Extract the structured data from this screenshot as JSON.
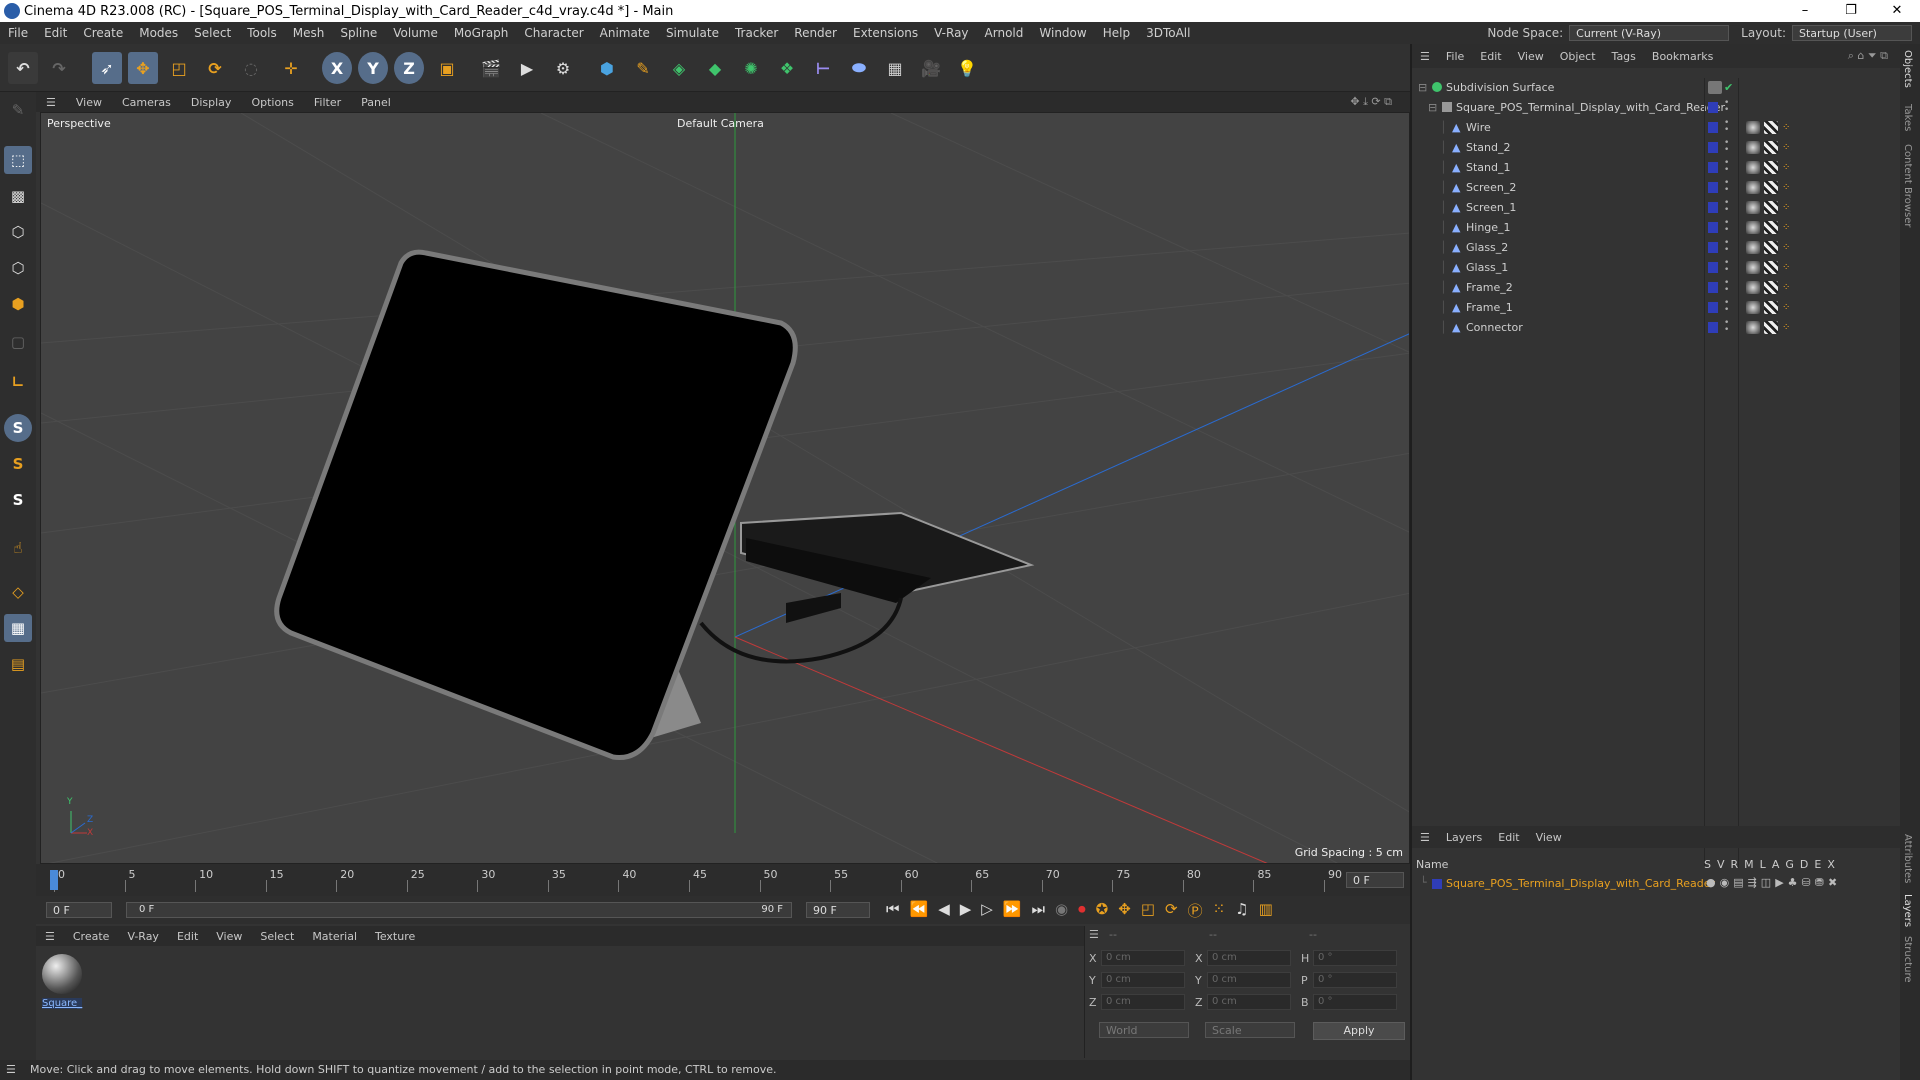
{
  "window": {
    "title": "Cinema 4D R23.008 (RC) - [Square_POS_Terminal_Display_with_Card_Reader_c4d_vray.c4d *] - Main",
    "controls": [
      "–",
      "❐",
      "✕"
    ]
  },
  "menubar": {
    "items": [
      "File",
      "Edit",
      "Create",
      "Modes",
      "Select",
      "Tools",
      "Mesh",
      "Spline",
      "Volume",
      "MoGraph",
      "Character",
      "Animate",
      "Simulate",
      "Tracker",
      "Render",
      "Extensions",
      "V-Ray",
      "Arnold",
      "Window",
      "Help",
      "3DToAll"
    ],
    "node_space_label": "Node Space:",
    "node_space_value": "Current (V-Ray)",
    "layout_label": "Layout:",
    "layout_value": "Startup (User)"
  },
  "toolbar": {
    "axis_x": "X",
    "axis_y": "Y",
    "axis_z": "Z"
  },
  "viewport": {
    "menu": [
      "View",
      "Cameras",
      "Display",
      "Options",
      "Filter",
      "Panel"
    ],
    "label": "Perspective",
    "camera": "Default Camera",
    "grid_spacing": "Grid Spacing : 5 cm",
    "axis_x": "X",
    "axis_y": "Y",
    "axis_z": "Z"
  },
  "timeline": {
    "ticks": [
      "0",
      "5",
      "10",
      "15",
      "20",
      "25",
      "30",
      "35",
      "40",
      "45",
      "50",
      "55",
      "60",
      "65",
      "70",
      "75",
      "80",
      "85",
      "90"
    ],
    "current_frame": "0 F",
    "start_field": "0 F",
    "range_start": "0 F",
    "range_end": "90 F",
    "end_field": "90 F"
  },
  "material_manager": {
    "menu": [
      "Create",
      "V-Ray",
      "Edit",
      "View",
      "Select",
      "Material",
      "Texture"
    ],
    "material_name": "Square_"
  },
  "coordinates": {
    "header": [
      "--",
      "--",
      "--"
    ],
    "rows": [
      {
        "a": "X",
        "av": "0 cm",
        "b": "X",
        "bv": "0 cm",
        "c": "H",
        "cv": "0 °"
      },
      {
        "a": "Y",
        "av": "0 cm",
        "b": "Y",
        "bv": "0 cm",
        "c": "P",
        "cv": "0 °"
      },
      {
        "a": "Z",
        "av": "0 cm",
        "b": "Z",
        "bv": "0 cm",
        "c": "B",
        "cv": "0 °"
      }
    ],
    "mode1": "World",
    "mode2": "Scale",
    "apply": "Apply"
  },
  "status": "Move: Click and drag to move elements. Hold down SHIFT to quantize movement / add to the selection in point mode, CTRL to remove.",
  "object_manager": {
    "menu": [
      "File",
      "Edit",
      "View",
      "Object",
      "Tags",
      "Bookmarks"
    ],
    "root": "Subdivision Surface",
    "group": "Square_POS_Terminal_Display_with_Card_Reader",
    "children": [
      "Wire",
      "Stand_2",
      "Stand_1",
      "Screen_2",
      "Screen_1",
      "Hinge_1",
      "Glass_2",
      "Glass_1",
      "Frame_2",
      "Frame_1",
      "Connector"
    ]
  },
  "layers": {
    "menu": [
      "Layers",
      "Edit",
      "View"
    ],
    "name_header": "Name",
    "flags": [
      "S",
      "V",
      "R",
      "M",
      "L",
      "A",
      "G",
      "D",
      "E",
      "X"
    ],
    "layer_name": "Square_POS_Terminal_Display_with_Card_Reader"
  },
  "side_tabs": [
    "Objects",
    "Takes",
    "Content Browser",
    "Attributes",
    "Layers",
    "Structure"
  ]
}
